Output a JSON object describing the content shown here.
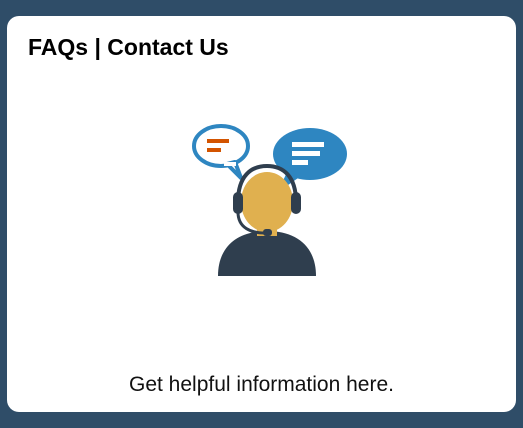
{
  "tile": {
    "title": "FAQs | Contact Us",
    "description": "Get helpful information here.",
    "icon": "customer-support-agent-icon"
  },
  "colors": {
    "page_background": "#2f4d68",
    "tile_background": "#ffffff",
    "bubble_blue": "#2e86c1",
    "bubble_line_orange": "#d35400",
    "skin": "#e0b04f",
    "body_dark": "#2f3e4e"
  }
}
